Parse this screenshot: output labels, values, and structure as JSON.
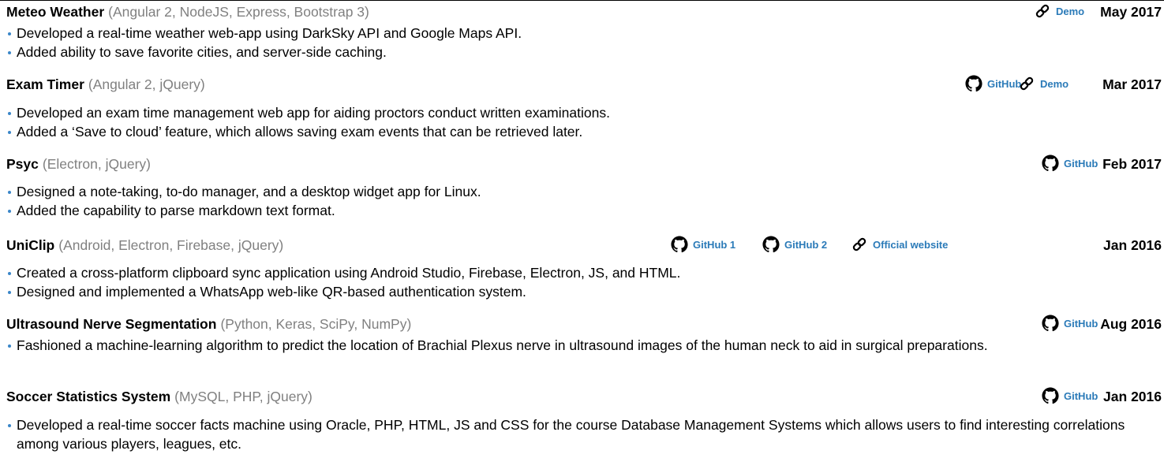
{
  "projects": [
    {
      "name": "Meteo Weather",
      "tech": "(Angular 2, NodeJS, Express, Bootstrap 3)",
      "links": [
        {
          "label": "Demo",
          "icon": "link-icon"
        }
      ],
      "date": "May 2017",
      "bullets": [
        "Developed a real-time weather web-app using DarkSky API and Google Maps API.",
        "Added ability to save favorite cities, and server-side caching."
      ]
    },
    {
      "name": "Exam Timer",
      "tech": "(Angular 2, jQuery)",
      "links": [
        {
          "label": "GitHub",
          "icon": "github-icon"
        },
        {
          "label": "Demo",
          "icon": "link-icon"
        }
      ],
      "date": "Mar 2017",
      "bullets": [
        "Developed an exam time management web app for aiding proctors conduct written examinations.",
        "Added a ‘Save to cloud’ feature, which allows saving exam events that can be retrieved later."
      ]
    },
    {
      "name": "Psyc",
      "tech": "(Electron, jQuery)",
      "links": [
        {
          "label": "GitHub",
          "icon": "github-icon"
        }
      ],
      "date": "Feb 2017",
      "bullets": [
        "Designed a note-taking, to-do manager, and a desktop widget app for Linux.",
        "Added the capability to parse markdown text format."
      ]
    },
    {
      "name": "UniClip",
      "tech": "(Android, Electron, Firebase, jQuery)",
      "links": [
        {
          "label": "GitHub 1",
          "icon": "github-icon"
        },
        {
          "label": "GitHub 2",
          "icon": "github-icon"
        },
        {
          "label": "Official website",
          "icon": "link-icon"
        }
      ],
      "date": "Jan 2016",
      "bullets": [
        "Created a cross-platform clipboard sync application using Android Studio, Firebase, Electron, JS, and HTML.",
        "Designed and implemented a WhatsApp web-like QR-based authentication system."
      ]
    },
    {
      "name": "Ultrasound Nerve Segmentation",
      "tech": "(Python, Keras, SciPy, NumPy)",
      "links": [
        {
          "label": "GitHub",
          "icon": "github-icon"
        }
      ],
      "date": "Aug 2016",
      "bullets": [
        "Fashioned a machine-learning algorithm to predict the location of Brachial Plexus nerve in ultrasound images of the human neck to aid in surgical preparations."
      ]
    },
    {
      "name": "Soccer Statistics System",
      "tech": "(MySQL, PHP, jQuery)",
      "links": [
        {
          "label": "GitHub",
          "icon": "github-icon"
        }
      ],
      "date": "Jan 2016",
      "bullets": [
        "Developed a real-time soccer facts machine using Oracle, PHP, HTML, JS and CSS for the course Database Management Systems which allows users to find interesting correlations among various players, leagues, etc."
      ]
    }
  ]
}
